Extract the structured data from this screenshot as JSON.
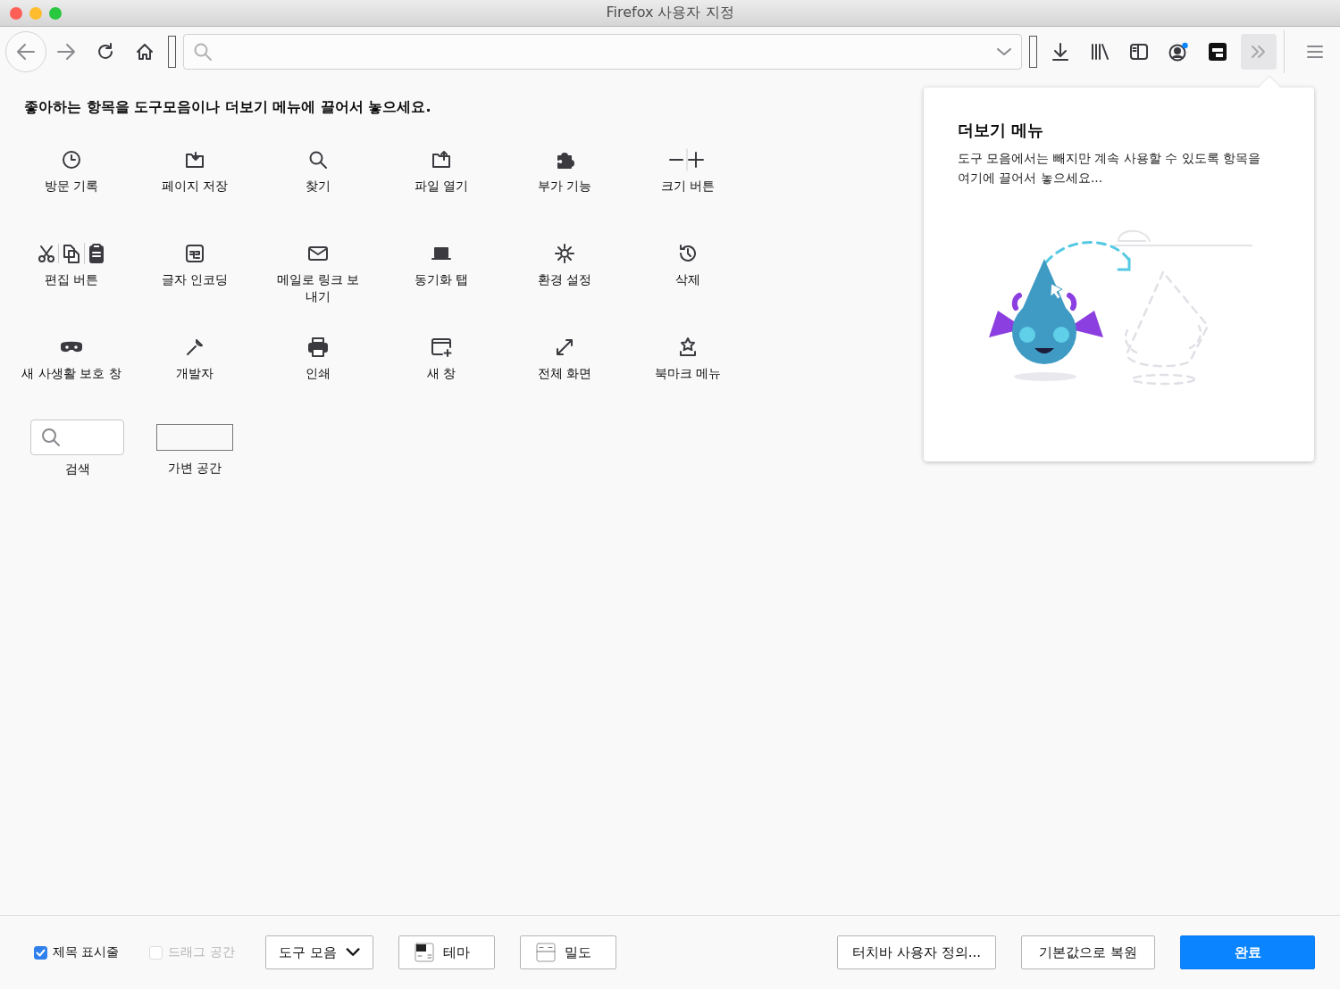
{
  "window": {
    "title": "Firefox 사용자 지정"
  },
  "palette": {
    "heading": "좋아하는 항목을 도구모음이나 더보기 메뉴에 끌어서 놓으세요.",
    "items": [
      {
        "kind": "button",
        "label": "방문 기록"
      },
      {
        "kind": "button",
        "label": "페이지 저장"
      },
      {
        "kind": "button",
        "label": "찾기"
      },
      {
        "kind": "button",
        "label": "파일 열기"
      },
      {
        "kind": "button",
        "label": "부가 기능"
      },
      {
        "kind": "button",
        "label": "크기 버튼"
      },
      {
        "kind": "button",
        "label": "편집 버튼"
      },
      {
        "kind": "button",
        "label": "글자 인코딩"
      },
      {
        "kind": "button",
        "label": "메일로 링크 보내기"
      },
      {
        "kind": "button",
        "label": "동기화 탭"
      },
      {
        "kind": "button",
        "label": "환경 설정"
      },
      {
        "kind": "button",
        "label": "삭제"
      },
      {
        "kind": "button",
        "label": "새 사생활 보호 창"
      },
      {
        "kind": "button",
        "label": "개발자"
      },
      {
        "kind": "button",
        "label": "인쇄"
      },
      {
        "kind": "button",
        "label": "새 창"
      },
      {
        "kind": "button",
        "label": "전체 화면"
      },
      {
        "kind": "button",
        "label": "북마크 메뉴"
      },
      {
        "kind": "search",
        "label": "검색"
      },
      {
        "kind": "spacer",
        "label": "가변 공간"
      }
    ]
  },
  "overflow_panel": {
    "title": "더보기 메뉴",
    "text": "도구 모음에서는 빼지만 계속 사용할 수 있도록 항목을 여기에 끌어서 놓으세요..."
  },
  "footer": {
    "checkboxes": [
      {
        "label": "제목 표시줄",
        "checked": true,
        "disabled": false
      },
      {
        "label": "드래그 공간",
        "checked": false,
        "disabled": true
      }
    ],
    "toolbars_dropdown": {
      "value": "도구 모음"
    },
    "buttons": [
      {
        "kind": "theme",
        "label": "테마"
      },
      {
        "kind": "density",
        "label": "밀도"
      },
      {
        "kind": "plain",
        "label": "터치바 사용자 정의..."
      },
      {
        "kind": "plain",
        "label": "기본값으로 복원"
      },
      {
        "kind": "primary",
        "label": "완료"
      }
    ]
  }
}
